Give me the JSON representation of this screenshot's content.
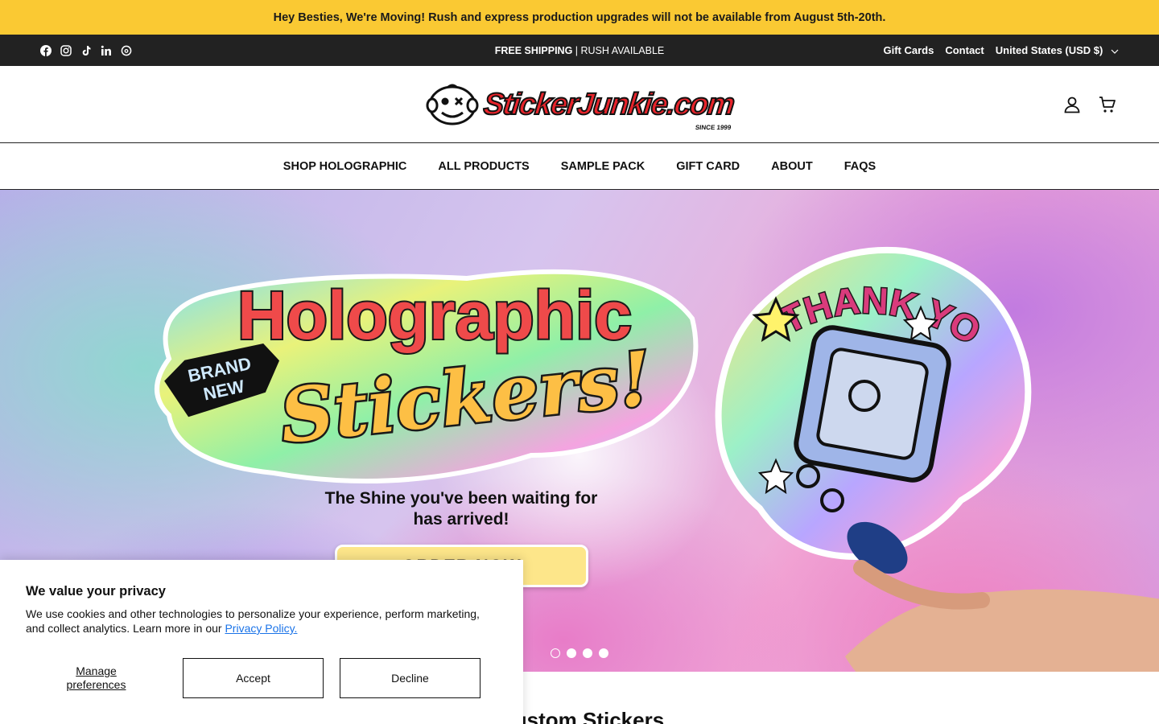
{
  "announcement": "Hey Besties, We're Moving! Rush and express production upgrades will not be available from August 5th-20th.",
  "topbar": {
    "socials": [
      "facebook-icon",
      "instagram-icon",
      "tiktok-icon",
      "linkedin-icon",
      "threads-icon"
    ],
    "shipping_bold": "FREE SHIPPING",
    "shipping_rest": " | RUSH AVAILABLE",
    "links": [
      "Gift Cards",
      "Contact"
    ],
    "currency": "United States (USD $)"
  },
  "header": {
    "logo_text": "StickerJunkie.com",
    "logo_since": "SINCE 1999",
    "icons": [
      "account-icon",
      "cart-icon"
    ]
  },
  "nav": [
    "SHOP HOLOGRAPHIC",
    "ALL PRODUCTS",
    "SAMPLE PACK",
    "GIFT CARD",
    "ABOUT",
    "FAQS"
  ],
  "hero": {
    "sticker_line1": "Holographic",
    "sticker_badge_1": "BRAND",
    "sticker_badge_2": "NEW",
    "sticker_line2": "Stickers!",
    "thank_you": "THANK YOU",
    "tagline_line1": "The Shine you've been waiting for",
    "tagline_line2": "has arrived!",
    "cta": "ORDER NOW",
    "slides": 4,
    "active_slide": 1
  },
  "below_title": "Custom Stickers",
  "cookie": {
    "title": "We value your privacy",
    "body": "We use cookies and other technologies to personalize your experience, perform marketing, and collect analytics. Learn more in our ",
    "link": "Privacy Policy.",
    "manage_line1": "Manage",
    "manage_line2": "preferences",
    "accept": "Accept",
    "decline": "Decline"
  },
  "colors": {
    "announce_bg": "#fac933",
    "topbar_bg": "#222222",
    "brand_red": "#e8242b",
    "cta_bg": "#fde68a",
    "link": "#1a73e8"
  }
}
